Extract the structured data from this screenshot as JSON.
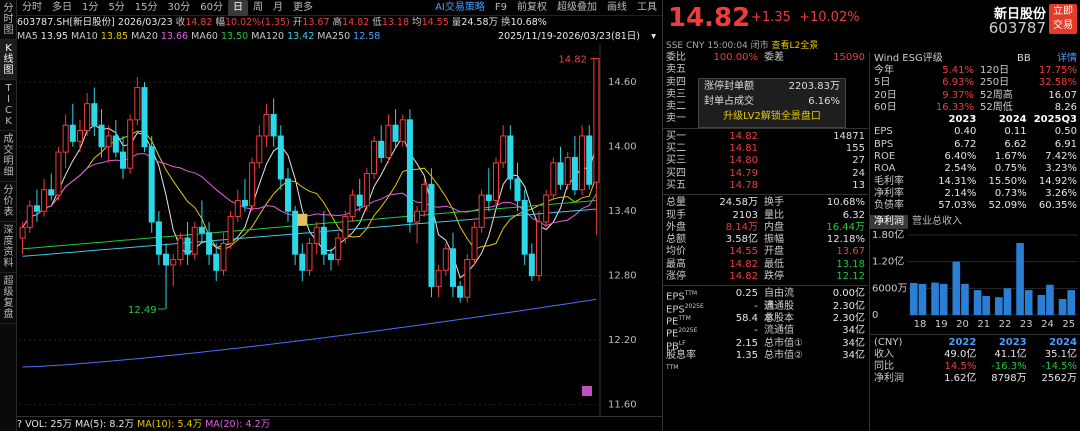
{
  "vtabs": [
    "分时图",
    "K线图",
    "TICK",
    "成交明细",
    "分价表",
    "深度资料",
    "超级复盘"
  ],
  "periods": [
    "分时",
    "多日",
    "1分",
    "5分",
    "15分",
    "30分",
    "60分",
    "日",
    "周",
    "月",
    "更多"
  ],
  "topright": [
    "AI交易策略",
    "F9",
    "前复权",
    "超级叠加",
    "画线",
    "工具"
  ],
  "info": {
    "code": "603787.SH[新日股份]",
    "date": "2026/03/23",
    "shou_l": "收",
    "shou": "14.82",
    "fu_l": "幅",
    "fu": "10.02%(1.35)",
    "kai_l": "开",
    "kai": "13.67",
    "gao_l": "高",
    "gao": "14.82",
    "di_l": "低",
    "di": "13.18",
    "jun_l": "均",
    "jun": "14.55",
    "liang_l": "量",
    "liang": "24.58万",
    "huan_l": "换",
    "huan": "10.68%"
  },
  "ma": {
    "ma5": "MA5",
    "ma5v": "13.95",
    "ma10": "MA10",
    "ma10v": "13.85",
    "ma20": "MA20",
    "ma20v": "13.66",
    "ma60": "MA60",
    "ma60v": "13.50",
    "ma120": "MA120",
    "ma120v": "13.42",
    "ma250": "MA250",
    "ma250v": "12.58",
    "range": "2025/11/19-2026/03/23(81日)"
  },
  "chart_data": {
    "type": "candlestick",
    "yticks": [
      "14.60",
      "14.00",
      "13.40",
      "12.80",
      "12.20",
      "11.60"
    ],
    "high_label": "14.82",
    "low_label": "12.49",
    "ylim": [
      11.55,
      14.9
    ],
    "candles": [
      [
        13.15,
        13.3,
        13.0,
        13.25
      ],
      [
        13.25,
        13.5,
        13.2,
        13.45
      ],
      [
        13.45,
        13.6,
        13.3,
        13.4
      ],
      [
        13.4,
        13.7,
        13.35,
        13.6
      ],
      [
        13.6,
        13.75,
        13.5,
        13.55
      ],
      [
        13.55,
        14.0,
        13.5,
        13.95
      ],
      [
        13.95,
        14.3,
        13.8,
        14.2
      ],
      [
        14.2,
        14.4,
        14.0,
        14.05
      ],
      [
        14.05,
        14.25,
        13.95,
        14.15
      ],
      [
        14.15,
        14.5,
        14.1,
        14.4
      ],
      [
        14.4,
        14.55,
        14.1,
        14.2
      ],
      [
        14.2,
        14.35,
        13.9,
        14.0
      ],
      [
        14.0,
        14.2,
        13.85,
        14.1
      ],
      [
        14.1,
        14.25,
        13.9,
        13.95
      ],
      [
        13.95,
        14.1,
        13.7,
        13.8
      ],
      [
        13.8,
        14.3,
        13.75,
        14.25
      ],
      [
        14.25,
        14.65,
        14.2,
        14.55
      ],
      [
        14.55,
        14.6,
        13.95,
        14.0
      ],
      [
        14.0,
        14.1,
        13.2,
        13.3
      ],
      [
        13.3,
        13.4,
        12.9,
        13.0
      ],
      [
        13.0,
        13.1,
        12.49,
        12.9
      ],
      [
        12.9,
        13.0,
        12.7,
        12.95
      ],
      [
        12.95,
        13.2,
        12.9,
        13.15
      ],
      [
        13.15,
        13.3,
        12.9,
        13.0
      ],
      [
        13.0,
        13.3,
        12.95,
        13.25
      ],
      [
        13.25,
        13.5,
        13.1,
        13.2
      ],
      [
        13.2,
        13.3,
        12.9,
        13.0
      ],
      [
        13.0,
        13.1,
        12.75,
        12.85
      ],
      [
        12.85,
        13.2,
        12.8,
        13.1
      ],
      [
        13.1,
        13.4,
        13.05,
        13.35
      ],
      [
        13.35,
        13.6,
        13.3,
        13.5
      ],
      [
        13.5,
        13.7,
        13.4,
        13.45
      ],
      [
        13.45,
        13.9,
        13.4,
        13.85
      ],
      [
        13.85,
        14.2,
        13.8,
        14.1
      ],
      [
        14.1,
        14.4,
        14.0,
        14.3
      ],
      [
        14.3,
        14.45,
        14.0,
        14.1
      ],
      [
        14.1,
        14.2,
        13.6,
        13.7
      ],
      [
        13.7,
        13.8,
        13.3,
        13.4
      ],
      [
        13.4,
        13.45,
        12.9,
        13.0
      ],
      [
        13.0,
        13.1,
        12.75,
        12.85
      ],
      [
        12.85,
        13.15,
        12.8,
        13.1
      ],
      [
        13.1,
        13.3,
        13.0,
        13.25
      ],
      [
        13.25,
        13.4,
        12.9,
        13.0
      ],
      [
        13.0,
        13.05,
        12.85,
        12.95
      ],
      [
        12.95,
        13.2,
        12.9,
        13.15
      ],
      [
        13.15,
        13.4,
        13.1,
        13.35
      ],
      [
        13.35,
        13.6,
        13.3,
        13.55
      ],
      [
        13.55,
        13.7,
        13.4,
        13.45
      ],
      [
        13.45,
        13.8,
        13.4,
        13.75
      ],
      [
        13.75,
        14.1,
        13.7,
        14.05
      ],
      [
        14.05,
        14.2,
        13.85,
        13.9
      ],
      [
        13.9,
        14.3,
        13.85,
        14.2
      ],
      [
        14.2,
        14.35,
        14.0,
        14.05
      ],
      [
        14.05,
        14.3,
        14.0,
        14.25
      ],
      [
        14.25,
        14.35,
        13.2,
        13.3
      ],
      [
        13.3,
        13.45,
        13.1,
        13.4
      ],
      [
        13.4,
        13.7,
        13.35,
        13.65
      ],
      [
        13.65,
        13.8,
        12.6,
        12.7
      ],
      [
        12.7,
        12.9,
        12.6,
        12.85
      ],
      [
        12.85,
        13.1,
        12.8,
        13.05
      ],
      [
        13.05,
        13.2,
        12.6,
        12.7
      ],
      [
        12.7,
        12.75,
        12.55,
        12.6
      ],
      [
        12.6,
        13.0,
        12.55,
        12.95
      ],
      [
        12.95,
        13.3,
        12.9,
        13.25
      ],
      [
        13.25,
        13.6,
        13.2,
        13.55
      ],
      [
        13.55,
        13.8,
        13.4,
        13.5
      ],
      [
        13.5,
        13.9,
        13.45,
        13.85
      ],
      [
        13.85,
        14.2,
        13.8,
        14.1
      ],
      [
        14.1,
        14.2,
        13.6,
        13.7
      ],
      [
        13.7,
        13.85,
        13.4,
        13.5
      ],
      [
        13.5,
        13.6,
        12.9,
        13.0
      ],
      [
        13.0,
        13.1,
        12.75,
        12.8
      ],
      [
        12.8,
        13.4,
        12.75,
        13.3
      ],
      [
        13.3,
        13.6,
        13.25,
        13.55
      ],
      [
        13.55,
        13.9,
        13.5,
        13.85
      ],
      [
        13.85,
        14.0,
        13.6,
        13.65
      ],
      [
        13.65,
        13.95,
        13.6,
        13.9
      ],
      [
        13.9,
        14.1,
        13.55,
        13.6
      ],
      [
        13.6,
        14.2,
        13.55,
        14.1
      ],
      [
        14.1,
        14.2,
        13.6,
        13.65
      ],
      [
        13.67,
        14.82,
        13.18,
        14.82
      ]
    ]
  },
  "vol": {
    "label": "VOL: 25万",
    "ma5": "MA(5): 8.2万",
    "ma10": "MA(10): 5.4万",
    "ma20": "MA(20): 4.2万",
    "q": "?"
  },
  "quote": {
    "price": "14.82",
    "chg": "+1.35",
    "pct": "+10.02%",
    "name": "新日股份",
    "code": "603787",
    "btn": "立即交易",
    "sub": "SSE  CNY  15:00:04",
    "closed": "闭市",
    "l2": "查看L2全景"
  },
  "ob": {
    "webi_l": "委比",
    "webi": "100.00%",
    "wecha_l": "委差",
    "wecha": "15090",
    "sells": [
      {
        "l": "卖五",
        "p": "",
        "q": ""
      },
      {
        "l": "卖四",
        "p": "",
        "q": ""
      },
      {
        "l": "卖三",
        "p": "",
        "q": ""
      },
      {
        "l": "卖二",
        "p": "",
        "q": ""
      },
      {
        "l": "卖一",
        "p": "",
        "q": ""
      }
    ],
    "buys": [
      {
        "l": "买一",
        "p": "14.82",
        "q": "14871"
      },
      {
        "l": "买二",
        "p": "14.81",
        "q": "155"
      },
      {
        "l": "买三",
        "p": "14.80",
        "q": "27"
      },
      {
        "l": "买四",
        "p": "14.79",
        "q": "24"
      },
      {
        "l": "买五",
        "p": "14.78",
        "q": "13"
      }
    ],
    "popup": {
      "a1": "涨停封单额",
      "v1": "2203.83万",
      "a2": "封单占成交",
      "v2": "6.16%",
      "up": "升级LV2解锁全景盘口"
    }
  },
  "stats": [
    [
      "总量",
      "24.58万",
      "换手",
      "10.68%"
    ],
    [
      "现手",
      "2103",
      "量比",
      "6.32"
    ],
    [
      "外盘",
      "8.14万",
      "内盘",
      "16.44万"
    ],
    [
      "总额",
      "3.58亿",
      "振幅",
      "12.18%"
    ],
    [
      "均价",
      "14.55",
      "开盘",
      "13.67"
    ],
    [
      "最高",
      "14.82",
      "最低",
      "13.18"
    ],
    [
      "涨停",
      "14.82",
      "跌停",
      "12.12"
    ]
  ],
  "fund": [
    [
      "EPS",
      "TTM",
      "0.25",
      "自由流通",
      "0.00亿"
    ],
    [
      "EPS",
      "2025E",
      "-",
      "流通股本",
      "2.30亿"
    ],
    [
      "PE",
      "TTM",
      "58.4",
      "总股本",
      "2.30亿"
    ],
    [
      "PE",
      "2025E",
      "-",
      "流通值",
      "34亿"
    ],
    [
      "PB",
      "LF",
      "2.15",
      "总市值①",
      "34亿"
    ],
    [
      "股息率",
      "TTM",
      "1.35",
      "总市值②",
      "34亿"
    ]
  ],
  "wind": {
    "t": "Wind ESG评级",
    "r": "BB",
    "d": "详情"
  },
  "perf": [
    [
      "今年",
      "5.41%",
      "120日",
      "17.75%"
    ],
    [
      "5日",
      "6.93%",
      "250日",
      "32.58%"
    ],
    [
      "20日",
      "9.37%",
      "52周高",
      "16.07"
    ],
    [
      "60日",
      "16.33%",
      "52周低",
      "8.26"
    ]
  ],
  "fin_head": [
    "",
    "2023",
    "2024",
    "2025Q3"
  ],
  "fin": [
    [
      "EPS",
      "0.40",
      "0.11",
      "0.50"
    ],
    [
      "BPS",
      "6.72",
      "6.62",
      "6.91"
    ],
    [
      "ROE",
      "6.40%",
      "1.67%",
      "7.42%"
    ],
    [
      "ROA",
      "2.54%",
      "0.75%",
      "3.23%"
    ],
    [
      "毛利率",
      "14.31%",
      "15.50%",
      "14.92%"
    ],
    [
      "净利率",
      "2.14%",
      "0.73%",
      "3.26%"
    ],
    [
      "负债率",
      "57.03%",
      "52.09%",
      "60.35%"
    ]
  ],
  "ftabs": [
    "净利润",
    "营业总收入"
  ],
  "bar_chart": {
    "yticks": [
      "1.80亿",
      "1.20亿",
      "6000万",
      "0"
    ],
    "xlabels": [
      "18",
      "19",
      "20",
      "21",
      "22",
      "23",
      "24",
      "25"
    ]
  },
  "bars": [
    {
      "year": "18",
      "values": [
        0.72,
        0.7
      ]
    },
    {
      "year": "19",
      "values": [
        0.73,
        0.7
      ]
    },
    {
      "year": "20",
      "values": [
        1.2,
        0.7
      ]
    },
    {
      "year": "21",
      "values": [
        0.56,
        0.43
      ]
    },
    {
      "year": "22",
      "values": [
        0.4,
        0.6
      ]
    },
    {
      "year": "23",
      "values": [
        1.62,
        0.56
      ]
    },
    {
      "year": "24",
      "values": [
        0.45,
        0.68
      ]
    },
    {
      "year": "25",
      "values": [
        0.36,
        0.56
      ]
    }
  ],
  "sumt": {
    "h": [
      "(CNY)",
      "2022",
      "2023",
      "2024"
    ],
    "r": [
      [
        "收入",
        "49.0亿",
        "41.1亿",
        "35.1亿"
      ],
      [
        "同比",
        "14.5%",
        "-16.3%",
        "-14.5%"
      ],
      [
        "净利润",
        "1.62亿",
        "8798万",
        "2562万"
      ]
    ]
  }
}
